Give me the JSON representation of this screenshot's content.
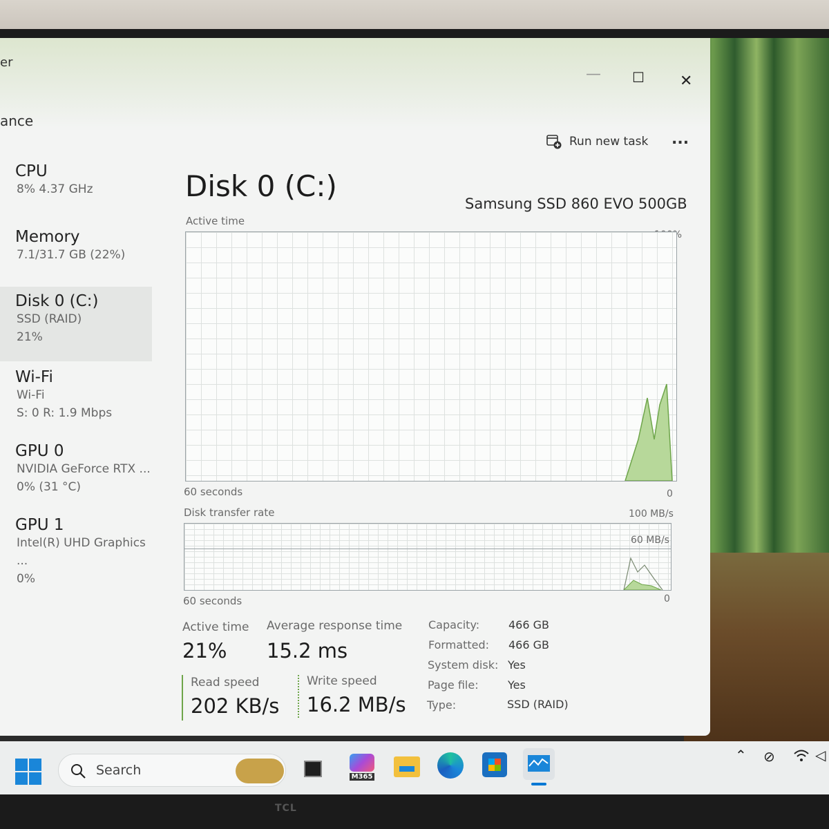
{
  "window": {
    "title_fragment": "er",
    "section_fragment": "ance",
    "run_new_task": "Run new task",
    "more": "...",
    "minimize": "—",
    "maximize": "☐",
    "close": "✕"
  },
  "sidebar": {
    "items": [
      {
        "title": "CPU",
        "line1": "8%  4.37 GHz",
        "line2": "",
        "line3": ""
      },
      {
        "title": "Memory",
        "line1": "7.1/31.7 GB (22%)",
        "line2": "",
        "line3": ""
      },
      {
        "title": "Disk 0 (C:)",
        "line1": "SSD (RAID)",
        "line2": "21%",
        "line3": ""
      },
      {
        "title": "Wi-Fi",
        "line1": "Wi-Fi",
        "line2": "S: 0  R: 1.9 Mbps",
        "line3": ""
      },
      {
        "title": "GPU 0",
        "line1": "NVIDIA GeForce RTX ...",
        "line2": "0%  (31 °C)",
        "line3": ""
      },
      {
        "title": "GPU 1",
        "line1": "Intel(R) UHD Graphics ...",
        "line2": "0%",
        "line3": ""
      }
    ]
  },
  "main": {
    "title": "Disk 0 (C:)",
    "device": "Samsung SSD 860 EVO 500GB",
    "active_graph": {
      "label": "Active time",
      "max": "100%",
      "time_label": "60 seconds",
      "zero": "0"
    },
    "transfer_graph": {
      "label": "Disk transfer rate",
      "max": "100 MB/s",
      "mid": "60 MB/s",
      "time_label": "60 seconds",
      "zero": "0"
    },
    "stats": {
      "active_time_label": "Active time",
      "active_time_value": "21%",
      "response_label": "Average response time",
      "response_value": "15.2 ms",
      "read_label": "Read speed",
      "read_value": "202 KB/s",
      "write_label": "Write speed",
      "write_value": "16.2 MB/s"
    },
    "info": [
      {
        "label": "Capacity:",
        "value": "466 GB"
      },
      {
        "label": "Formatted:",
        "value": "466 GB"
      },
      {
        "label": "System disk:",
        "value": "Yes"
      },
      {
        "label": "Page file:",
        "value": "Yes"
      },
      {
        "label": "Type:",
        "value": "SSD (RAID)"
      }
    ]
  },
  "taskbar": {
    "search_label": "Search",
    "m365_label": "M365",
    "brand": "TCL"
  },
  "colors": {
    "graph_fill": "#b7d89a",
    "graph_line": "#6ea54a",
    "accent": "#0078d4"
  }
}
